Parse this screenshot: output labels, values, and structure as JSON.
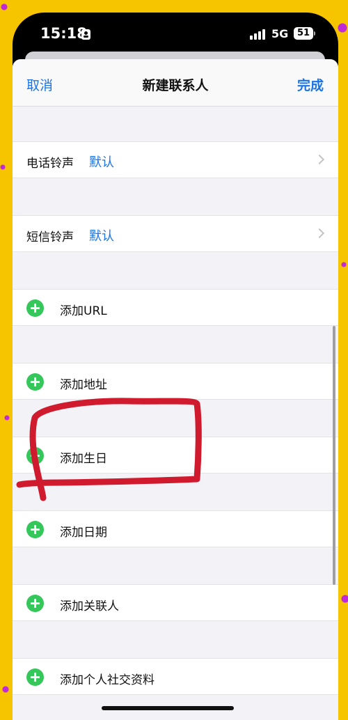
{
  "status_bar": {
    "time": "15:18",
    "network": "5G",
    "battery": "51"
  },
  "nav": {
    "cancel_label": "取消",
    "title": "新建联系人",
    "done_label": "完成"
  },
  "settings_rows": [
    {
      "label": "电话铃声",
      "value": "默认"
    },
    {
      "label": "短信铃声",
      "value": "默认"
    }
  ],
  "add_rows": [
    {
      "label": "添加URL"
    },
    {
      "label": "添加地址"
    },
    {
      "label": "添加生日"
    },
    {
      "label": "添加日期"
    },
    {
      "label": "添加关联人"
    },
    {
      "label": "添加个人社交资料"
    }
  ],
  "colors": {
    "accent": "#1a73e8",
    "add_green": "#34c759",
    "annotation_red": "#d01a2e",
    "background_yellow": "#f7c400"
  }
}
